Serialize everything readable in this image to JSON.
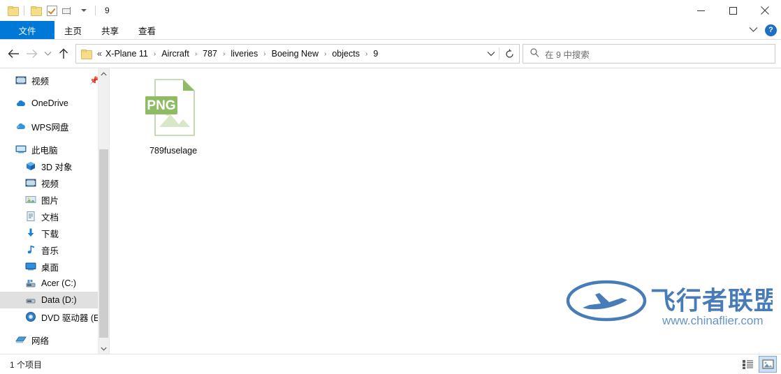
{
  "window": {
    "title": "9",
    "quick_access": [
      {
        "name": "folder-icon",
        "tooltip": "文件夹"
      },
      {
        "name": "folder-properties-icon",
        "tooltip": "属性"
      },
      {
        "name": "checkbox-icon",
        "tooltip": "选择"
      },
      {
        "name": "properties-icon",
        "tooltip": "属性"
      },
      {
        "name": "chevron-down-icon",
        "tooltip": "自定义快速访问工具栏"
      }
    ],
    "controls": {
      "minimize": "—",
      "maximize": "▢",
      "close": "✕"
    }
  },
  "ribbon": {
    "tabs": [
      {
        "label": "文件",
        "active": true
      },
      {
        "label": "主页",
        "active": false
      },
      {
        "label": "共享",
        "active": false
      },
      {
        "label": "查看",
        "active": false
      }
    ],
    "collapse_icon": "chevron-down-icon",
    "help_label": "?"
  },
  "address": {
    "back_icon": "arrow-left-icon",
    "forward_icon": "arrow-right-icon",
    "recent_icon": "chevron-down-icon",
    "up_icon": "arrow-up-icon",
    "overflow": "«",
    "breadcrumbs": [
      "X-Plane 11",
      "Aircraft",
      "787",
      "liveries",
      "Boeing New",
      "objects",
      "9"
    ],
    "separator": "›",
    "dropdown_icon": "chevron-down-icon",
    "refresh_icon": "refresh-icon"
  },
  "search": {
    "icon": "search-icon",
    "placeholder": "在 9 中搜索",
    "value": ""
  },
  "sidebar": {
    "items": [
      {
        "label": "视频",
        "icon": "video-icon",
        "indent": false,
        "selected": false,
        "pinned": true,
        "gap_before": false
      },
      {
        "label": "OneDrive",
        "icon": "onedrive-cloud-icon",
        "indent": false,
        "selected": false,
        "pinned": false,
        "gap_before": true
      },
      {
        "label": "WPS网盘",
        "icon": "wps-cloud-icon",
        "indent": false,
        "selected": false,
        "pinned": false,
        "gap_before": true
      },
      {
        "label": "此电脑",
        "icon": "this-pc-icon",
        "indent": false,
        "selected": false,
        "pinned": false,
        "gap_before": true
      },
      {
        "label": "3D 对象",
        "icon": "3d-objects-icon",
        "indent": true,
        "selected": false,
        "pinned": false,
        "gap_before": false
      },
      {
        "label": "视频",
        "icon": "video-icon",
        "indent": true,
        "selected": false,
        "pinned": false,
        "gap_before": false
      },
      {
        "label": "图片",
        "icon": "pictures-icon",
        "indent": true,
        "selected": false,
        "pinned": false,
        "gap_before": false
      },
      {
        "label": "文档",
        "icon": "documents-icon",
        "indent": true,
        "selected": false,
        "pinned": false,
        "gap_before": false
      },
      {
        "label": "下载",
        "icon": "downloads-icon",
        "indent": true,
        "selected": false,
        "pinned": false,
        "gap_before": false
      },
      {
        "label": "音乐",
        "icon": "music-icon",
        "indent": true,
        "selected": false,
        "pinned": false,
        "gap_before": false
      },
      {
        "label": "桌面",
        "icon": "desktop-icon",
        "indent": true,
        "selected": false,
        "pinned": false,
        "gap_before": false
      },
      {
        "label": "Acer (C:)",
        "icon": "drive-icon",
        "indent": true,
        "selected": false,
        "pinned": false,
        "gap_before": false
      },
      {
        "label": "Data (D:)",
        "icon": "drive-icon",
        "indent": true,
        "selected": true,
        "pinned": false,
        "gap_before": false
      },
      {
        "label": "DVD 驱动器 (E:) XI",
        "icon": "dvd-drive-icon",
        "indent": true,
        "selected": false,
        "pinned": false,
        "gap_before": false
      },
      {
        "label": "网络",
        "icon": "network-icon",
        "indent": false,
        "selected": false,
        "pinned": false,
        "gap_before": true
      }
    ],
    "scroll_up_icon": "chevron-up-icon",
    "scroll_down_icon": "chevron-down-icon"
  },
  "files": [
    {
      "name": "789fuselage",
      "type": "PNG",
      "badge": "PNG",
      "icon": "png-file-icon",
      "selected": false
    }
  ],
  "status": {
    "item_count_text": "1 个项目",
    "view_details_icon": "details-view-icon",
    "view_large_icons_icon": "large-icons-view-icon",
    "active_view": "large-icons"
  },
  "watermark": {
    "title": "飞行者联盟",
    "url": "www.chinaflier.com",
    "color": "#3f76b5"
  },
  "colors": {
    "accent": "#0078d7",
    "selection": "#e0e0e0",
    "png_green": "#8ebb63",
    "folder_yellow": "#f7dc8c"
  }
}
